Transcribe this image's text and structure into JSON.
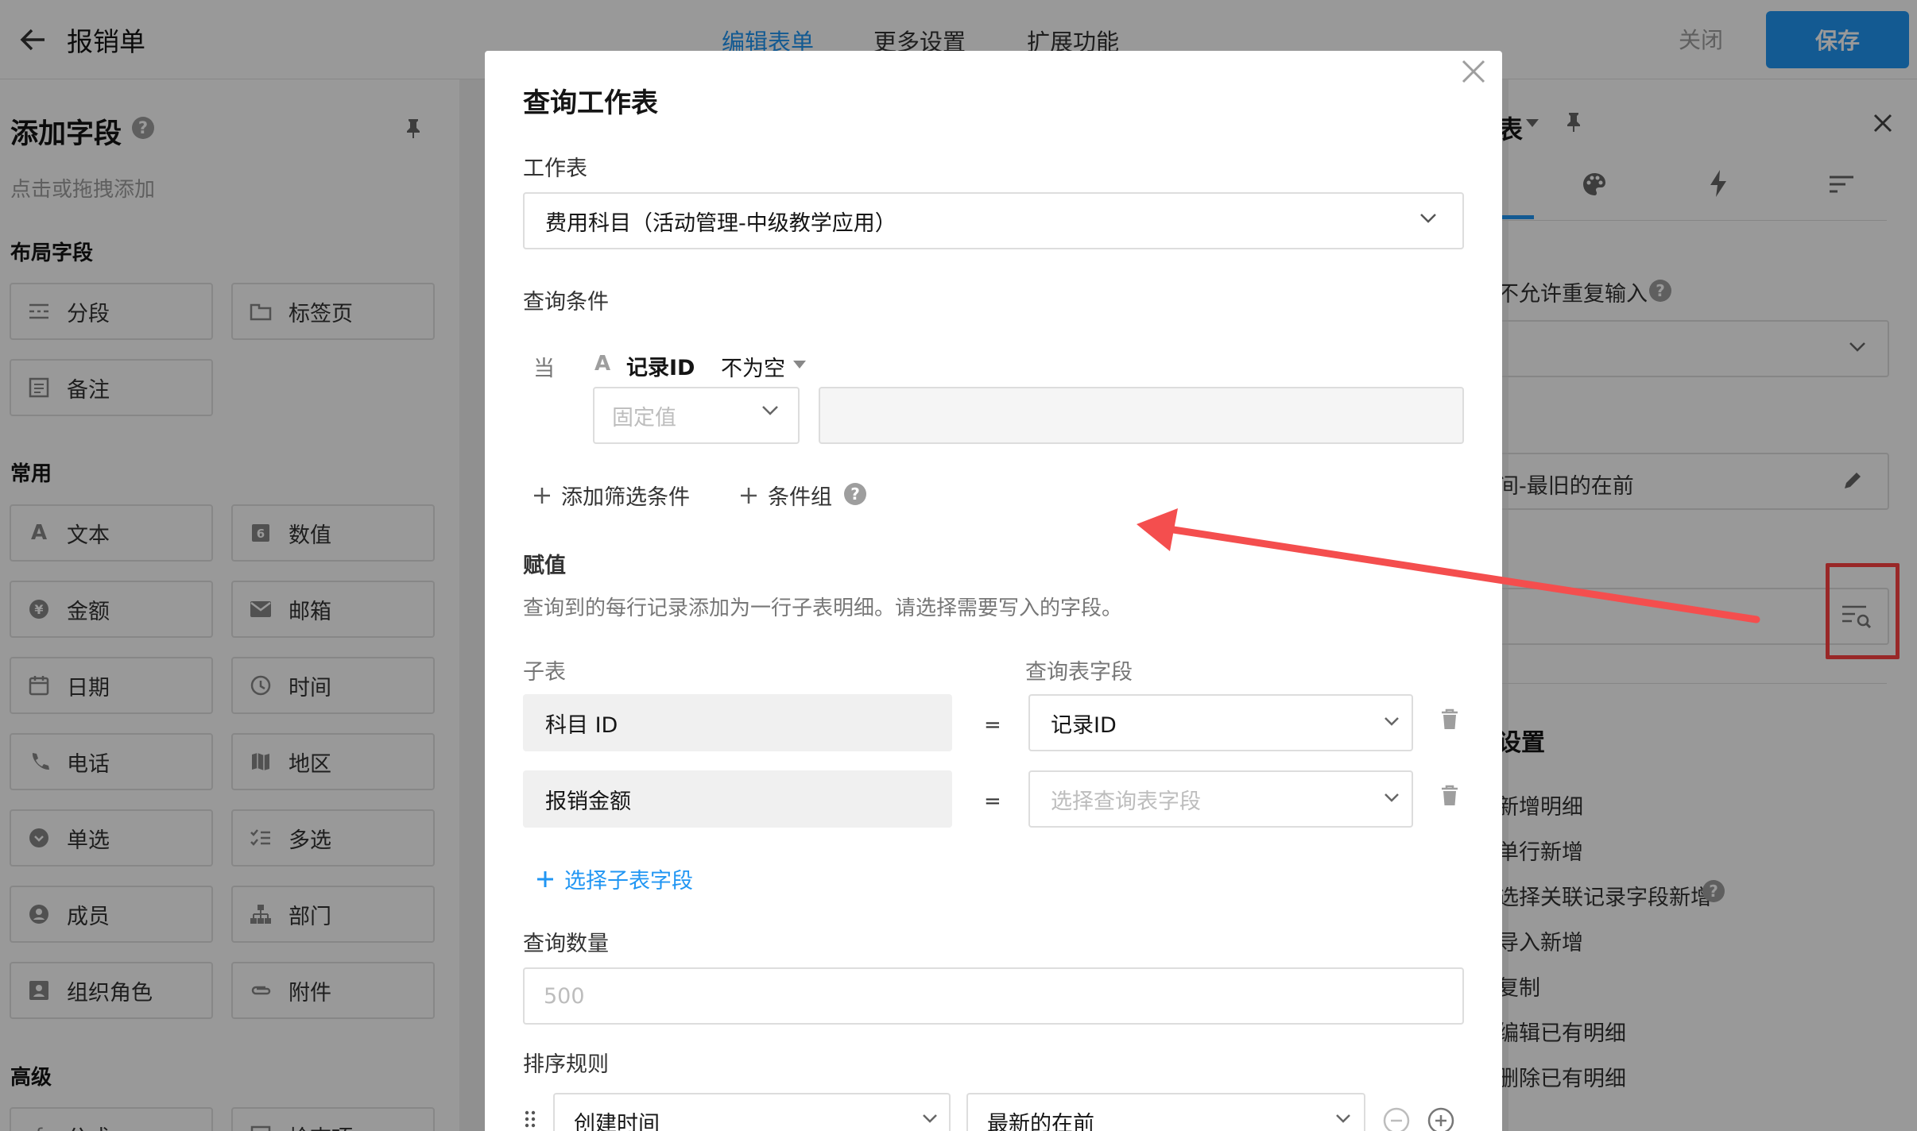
{
  "header": {
    "form_title": "报销单",
    "tabs": [
      "编辑表单",
      "更多设置",
      "扩展功能"
    ],
    "close_label": "关闭",
    "save_label": "保存"
  },
  "left_panel": {
    "title": "添加字段",
    "hint": "点击或拖拽添加",
    "sections": {
      "layout": "布局字段",
      "common": "常用",
      "advanced": "高级"
    },
    "layout_fields": [
      "分段",
      "标签页",
      "备注"
    ],
    "common_fields": [
      "文本",
      "数值",
      "金额",
      "邮箱",
      "日期",
      "时间",
      "电话",
      "地区",
      "单选",
      "多选",
      "成员",
      "部门",
      "组织角色",
      "附件"
    ],
    "advanced_fields": [
      "公式",
      "检查项"
    ]
  },
  "right_panel": {
    "title_fragment": "表",
    "unique_label": "不允许重复输入",
    "sort_value": "间-最旧的在前",
    "settings_title": "设置",
    "options": [
      "新增明细",
      "单行新增",
      "选择关联记录字段新增",
      "导入新增",
      "复制",
      "编辑已有明细",
      "删除已有明细"
    ]
  },
  "modal": {
    "title": "查询工作表",
    "worksheet_label": "工作表",
    "worksheet_value": "费用科目（活动管理-中级教学应用）",
    "conditions_label": "查询条件",
    "condition": {
      "when": "当",
      "type_icon": "A",
      "field": "记录ID",
      "operator": "不为空",
      "value_type": "固定值",
      "value": ""
    },
    "add_filter_label": "添加筛选条件",
    "add_group_label": "条件组",
    "assign_label": "赋值",
    "assign_desc": "查询到的每行记录添加为一行子表明细。请选择需要写入的字段。",
    "col_subtable": "子表",
    "col_query_field": "查询表字段",
    "mappings": [
      {
        "sub": "科目 ID",
        "eq": "=",
        "query": "记录ID",
        "placeholder": false
      },
      {
        "sub": "报销金额",
        "eq": "=",
        "query": "选择查询表字段",
        "placeholder": true
      }
    ],
    "add_subfield_label": "选择子表字段",
    "count_label": "查询数量",
    "count_placeholder": "500",
    "sort_label": "排序规则",
    "sort_field": "创建时间",
    "sort_direction": "最新的在前"
  },
  "colors": {
    "accent": "#2196f3",
    "annotation_red": "#f44e4e"
  }
}
